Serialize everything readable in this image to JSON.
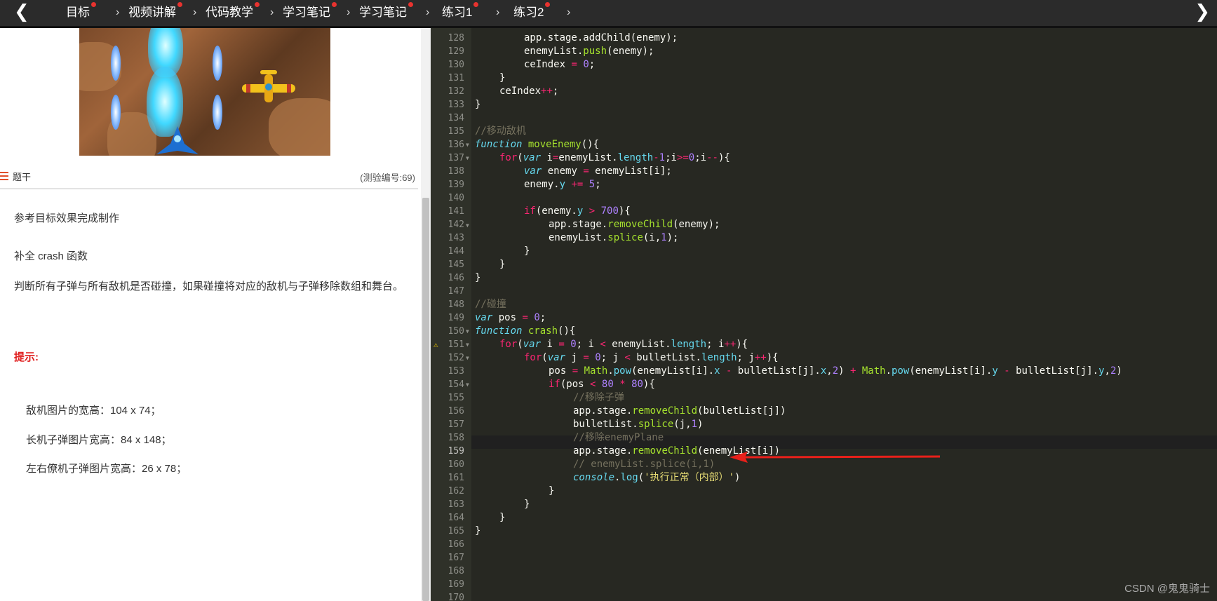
{
  "nav": {
    "tabs": [
      {
        "label": "目标"
      },
      {
        "label": "视频讲解"
      },
      {
        "label": "代码教学"
      },
      {
        "label": "学习笔记"
      },
      {
        "label": "学习笔记"
      },
      {
        "label": "练习1"
      },
      {
        "label": "练习2"
      }
    ],
    "back_icon": "chevron-left-icon",
    "forward_icon": "chevron-right-icon",
    "dot_color": "#e8332f"
  },
  "question": {
    "title": "题干",
    "quiz_id": "(测验编号:69)",
    "line1": "参考目标效果完成制作",
    "line2": "补全 crash 函数",
    "line3": "判断所有子弹与所有敌机是否碰撞，如果碰撞将对应的敌机与子弹移除数组和舞台。",
    "hint_label": "提示:",
    "spec1": "敌机图片的宽高：104 x 74；",
    "spec2": "长机子弹图片宽高：84 x 148；",
    "spec3": "左右僚机子弹图片宽高：26 x 78；"
  },
  "editor": {
    "line_numbers": [
      "128",
      "129",
      "130",
      "131",
      "132",
      "133",
      "134",
      "135",
      "136",
      "137",
      "138",
      "139",
      "140",
      "141",
      "142",
      "143",
      "144",
      "145",
      "146",
      "147",
      "148",
      "149",
      "150",
      "151",
      "152",
      "153",
      "154",
      "155",
      "156",
      "157",
      "158",
      "159",
      "160",
      "161",
      "162",
      "163",
      "164",
      "165",
      "166",
      "167",
      "168",
      "169",
      "170"
    ],
    "active_line": "159",
    "warning_line": "151",
    "code": {
      "l128": "app.stage.addChild(enemy);",
      "l129a": "enemyList.",
      "l129b": "push",
      "l129c": "(enemy);",
      "l130a": "ceIndex ",
      "l130b": "=",
      "l130c": " ",
      "l130d": "0",
      "l130e": ";",
      "l131": "}",
      "l132a": "ceIndex",
      "l132b": "++",
      "l132c": ";",
      "l133": "}",
      "l135": "//移动敌机",
      "l136a": "function",
      "l136b": " ",
      "l136c": "moveEnemy",
      "l136d": "(){",
      "l137a": "for",
      "l137b": "(",
      "l137c": "var",
      "l137d": " i",
      "l137e": "=",
      "l137f": "enemyList.",
      "l137g": "length",
      "l137h": "-",
      "l137i": "1",
      "l137j": ";i",
      "l137k": ">=",
      "l137l": "0",
      "l137m": ";i",
      "l137n": "--",
      "l137o": "){",
      "l138a": "var",
      "l138b": " enemy ",
      "l138c": "=",
      "l138d": " enemyList[i];",
      "l139a": "enemy.",
      "l139b": "y",
      "l139c": " ",
      "l139d": "+=",
      "l139e": " ",
      "l139f": "5",
      "l139g": ";",
      "l141a": "if",
      "l141b": "(enemy.",
      "l141c": "y",
      "l141d": " ",
      "l141e": ">",
      "l141f": " ",
      "l141g": "700",
      "l141h": "){",
      "l142a": "app.stage.",
      "l142b": "removeChild",
      "l142c": "(enemy);",
      "l143a": "enemyList.",
      "l143b": "splice",
      "l143c": "(i,",
      "l143d": "1",
      "l143e": ");",
      "l144": "}",
      "l145": "}",
      "l146": "}",
      "l148": "//碰撞",
      "l149a": "var",
      "l149b": " pos ",
      "l149c": "=",
      "l149d": " ",
      "l149e": "0",
      "l149f": ";",
      "l150a": "function",
      "l150b": " ",
      "l150c": "crash",
      "l150d": "(){",
      "l151a": "for",
      "l151b": "(",
      "l151c": "var",
      "l151d": " i ",
      "l151e": "=",
      "l151f": " ",
      "l151g": "0",
      "l151h": "; i ",
      "l151i": "<",
      "l151j": " enemyList.",
      "l151k": "length",
      "l151l": "; i",
      "l151m": "++",
      "l151n": "){",
      "l152a": "for",
      "l152b": "(",
      "l152c": "var",
      "l152d": " j ",
      "l152e": "=",
      "l152f": " ",
      "l152g": "0",
      "l152h": "; j ",
      "l152i": "<",
      "l152j": " bulletList.",
      "l152k": "length",
      "l152l": "; j",
      "l152m": "++",
      "l152n": "){",
      "l153a": "pos ",
      "l153b": "=",
      "l153c": " ",
      "l153d": "Math",
      "l153e": ".",
      "l153f": "pow",
      "l153g": "(enemyList[i].",
      "l153h": "x",
      "l153i": " ",
      "l153j": "-",
      "l153k": " bulletList[j].",
      "l153l": "x",
      "l153m": ",",
      "l153n": "2",
      "l153o": ") ",
      "l153p": "+",
      "l153q": " ",
      "l153r": "Math",
      "l153s": ".",
      "l153t": "pow",
      "l153u": "(enemyList[i].",
      "l153v": "y",
      "l153w": " ",
      "l153x": "-",
      "l153y": " bulletList[j].",
      "l153z": "y",
      "l153za": ",",
      "l153zb": "2",
      "l153zc": ")",
      "l154a": "if",
      "l154b": "(pos ",
      "l154c": "<",
      "l154d": " ",
      "l154e": "80",
      "l154f": " ",
      "l154g": "*",
      "l154h": " ",
      "l154i": "80",
      "l154j": "){",
      "l155": "//移除子弹",
      "l156a": "app.stage.",
      "l156b": "removeChild",
      "l156c": "(bulletList[j])",
      "l157a": "bulletList.",
      "l157b": "splice",
      "l157c": "(j,",
      "l157d": "1",
      "l157e": ")",
      "l158": "//移除enemyPlane",
      "l159a": "app.stage.",
      "l159b": "removeChild",
      "l159c": "(enemyList[i])",
      "l160": "// enemyList.splice(i,1)",
      "l161a": "console",
      "l161b": ".",
      "l161c": "log",
      "l161d": "(",
      "l161e": "'执行正常（内部）'",
      "l161f": ")",
      "l162": "}",
      "l163": "}",
      "l164": "}",
      "l165": "}"
    },
    "arrow_color": "#e8201a"
  },
  "watermark": "CSDN @鬼鬼骑士"
}
